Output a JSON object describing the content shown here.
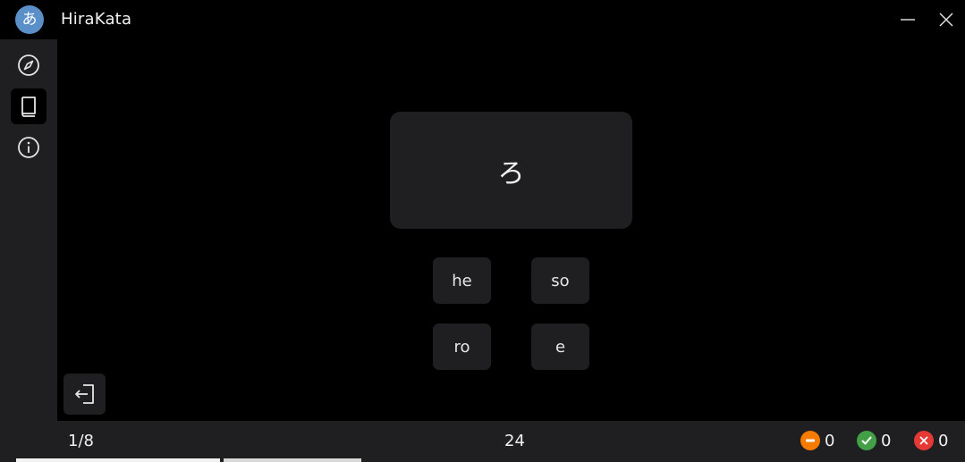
{
  "app": {
    "logo_glyph": "あ",
    "title": "HiraKata"
  },
  "window_controls": {
    "minimize_icon": "minimize-icon",
    "close_icon": "close-icon"
  },
  "sidebar": {
    "items": [
      {
        "name": "explore",
        "icon": "compass-icon",
        "active": false
      },
      {
        "name": "study",
        "icon": "book-icon",
        "active": true
      },
      {
        "name": "about",
        "icon": "info-icon",
        "active": false
      }
    ]
  },
  "quiz": {
    "prompt": "ろ",
    "choices": [
      "he",
      "so",
      "ro",
      "e"
    ]
  },
  "exit": {
    "icon": "exit-icon"
  },
  "status": {
    "progress": "1/8",
    "timer": "24",
    "skipped": "0",
    "correct": "0",
    "wrong": "0"
  },
  "colors": {
    "background": "#000000",
    "panel": "#1f1f22",
    "logo": "#5b8fc7",
    "skipped": "#f57c00",
    "correct": "#43a047",
    "wrong": "#e53935"
  }
}
